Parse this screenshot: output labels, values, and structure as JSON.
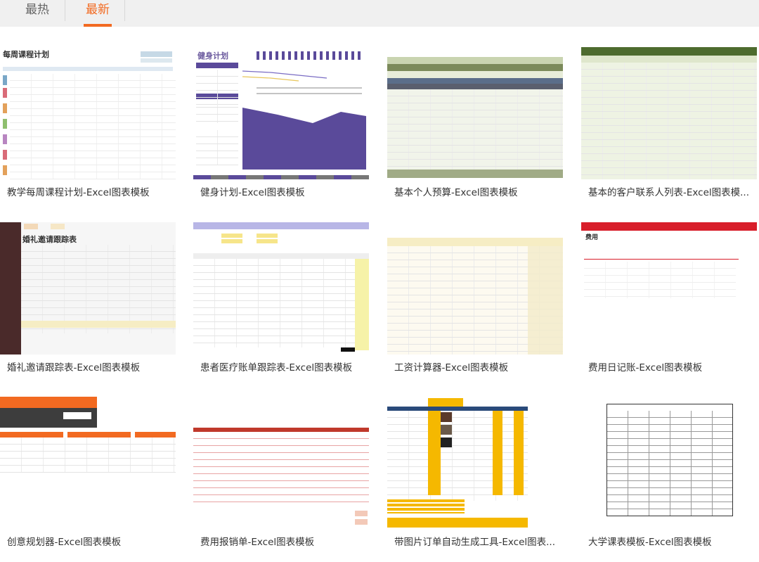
{
  "tabs": [
    {
      "label": "最热",
      "active": false
    },
    {
      "label": "最新",
      "active": true
    }
  ],
  "accent_color": "#f26a21",
  "templates": [
    {
      "title": "教学每周课程计划-Excel图表模板",
      "thumb_heading": "每周课程计划"
    },
    {
      "title": "健身计划-Excel图表模板",
      "thumb_heading": "健身计划"
    },
    {
      "title": "基本个人预算-Excel图表模板",
      "thumb_heading": ""
    },
    {
      "title": "基本的客户联系人列表-Excel图表模...",
      "thumb_heading": ""
    },
    {
      "title": "婚礼邀请跟踪表-Excel图表模板",
      "thumb_heading": "婚礼邀请跟踪表"
    },
    {
      "title": "患者医疗账单跟踪表-Excel图表模板",
      "thumb_heading": ""
    },
    {
      "title": "工资计算器-Excel图表模板",
      "thumb_heading": ""
    },
    {
      "title": "费用日记账-Excel图表模板",
      "thumb_heading": "费用"
    },
    {
      "title": "创意规划器-Excel图表模板",
      "thumb_heading": ""
    },
    {
      "title": "费用报销单-Excel图表模板",
      "thumb_heading": ""
    },
    {
      "title": "带图片订单自动生成工具-Excel图表...",
      "thumb_heading": ""
    },
    {
      "title": "大学课表模板-Excel图表模板",
      "thumb_heading": ""
    }
  ]
}
